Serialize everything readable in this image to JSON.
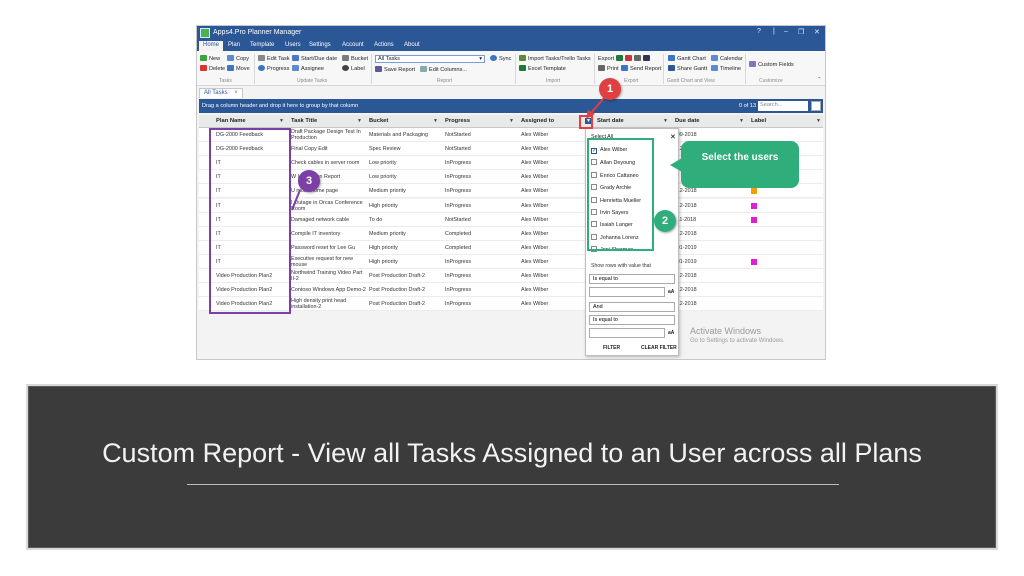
{
  "app": {
    "title": "Apps4.Pro Planner Manager",
    "window_controls": [
      "?",
      "|",
      "–",
      "❐",
      "✕"
    ],
    "menu_tabs": [
      "Home",
      "Plan",
      "Template",
      "Users",
      "Settings",
      "Account",
      "Actions",
      "About"
    ],
    "active_tab": "Home"
  },
  "ribbon": {
    "tasks": {
      "new": "New",
      "copy": "Copy",
      "delete": "Delete",
      "move": "Move",
      "group": "Tasks"
    },
    "update": {
      "edit_task": "Edit Task",
      "start_due": "Start/Due date",
      "bucket": "Bucket",
      "progress": "Progress",
      "assignee": "Assignee",
      "label": "Label",
      "group": "Update Tasks"
    },
    "report": {
      "selected": "All Tasks",
      "sync": "Sync",
      "save_report": "Save Report",
      "edit_columns": "Edit Columns...",
      "group": "Report"
    },
    "import": {
      "import_tasks": "Import Tasks/Trello Tasks",
      "excel_template": "Excel Template",
      "group": "Import"
    },
    "export": {
      "export": "Export",
      "print": "Print",
      "send_report": "Send Report",
      "group": "Export"
    },
    "gantt": {
      "gantt_chart": "Gantt Chart",
      "calendar": "Calendar",
      "share_gantt": "Share Gantt",
      "timeline": "Timeline",
      "group": "Gantt Chart and View"
    },
    "customize": {
      "custom_fields": "Custom Fields",
      "group": "Customize"
    }
  },
  "doc_tab": {
    "label": "All Tasks",
    "close": "×"
  },
  "group_bar": {
    "hint": "Drag a column header and drop it here to group by that column",
    "count": "0 of 13",
    "search_placeholder": "Search..."
  },
  "columns": [
    "Plan Name",
    "Task Title",
    "Bucket",
    "Progress",
    "Assigned to",
    "Start date",
    "Due date",
    "Label"
  ],
  "rows": [
    {
      "plan": "DG-2000 Feedback",
      "title": "Draft Package Design Test In Production",
      "bucket": "Materials and Packaging",
      "progress": "NotStarted",
      "assigned": "Alex Wilber",
      "due": "-09-2018",
      "label": ""
    },
    {
      "plan": "DG-2000 Feedback",
      "title": "Final Copy Edit",
      "bucket": "Spec Review",
      "progress": "NotStarted",
      "assigned": "Alex Wilber",
      "due": "-12-2",
      "label": ""
    },
    {
      "plan": "IT",
      "title": "Check cables in server room",
      "bucket": "Low priority",
      "progress": "InProgress",
      "assigned": "Alex Wilber",
      "due": "-01-",
      "label": ""
    },
    {
      "plan": "IT",
      "title": "W    Innovation Report",
      "bucket": "Low priority",
      "progress": "InProgress",
      "assigned": "Alex Wilber",
      "due": "",
      "label": ""
    },
    {
      "plan": "IT",
      "title": "U    ntoso home page",
      "bucket": "Medium priority",
      "progress": "InProgress",
      "assigned": "Alex Wilber",
      "due": "-12-2018",
      "label": "orange"
    },
    {
      "plan": "IT",
      "title": "I    Outage in Orcas Conference Room",
      "bucket": "High priority",
      "progress": "InProgress",
      "assigned": "Alex Wilber",
      "due": "-12-2018",
      "label": "magenta"
    },
    {
      "plan": "IT",
      "title": "Damaged network cable",
      "bucket": "To do",
      "progress": "NotStarted",
      "assigned": "Alex Wilber",
      "due": "-11-2018",
      "label": "magenta"
    },
    {
      "plan": "IT",
      "title": "Compile IT inventory",
      "bucket": "Medium priority",
      "progress": "Completed",
      "assigned": "Alex Wilber",
      "due": "-12-2018",
      "label": ""
    },
    {
      "plan": "IT",
      "title": "Password reset for Lee Gu",
      "bucket": "High priority",
      "progress": "Completed",
      "assigned": "Alex Wilber",
      "due": "-01-2019",
      "label": ""
    },
    {
      "plan": "IT",
      "title": "Executive request for new mouse",
      "bucket": "High priority",
      "progress": "InProgress",
      "assigned": "Alex Wilber",
      "due": "-01-2019",
      "label": "magenta"
    },
    {
      "plan": "Video Production Plan2",
      "title": "Northwind Training Video Part II-2",
      "bucket": "Post Production Draft-2",
      "progress": "InProgress",
      "assigned": "Alex Wilber",
      "due": "-12-2018",
      "label": ""
    },
    {
      "plan": "Video Production Plan2",
      "title": "Contoso Windows App Demo-2",
      "bucket": "Post Production Draft-2",
      "progress": "InProgress",
      "assigned": "Alex Wilber",
      "due": "-12-2018",
      "label": ""
    },
    {
      "plan": "Video Production Plan2",
      "title": "High density print head installation-2",
      "bucket": "Post Production Draft-2",
      "progress": "InProgress",
      "assigned": "Alex Wilber",
      "due": "-12-2018",
      "label": ""
    }
  ],
  "filter_dropdown": {
    "select_all": "Select All",
    "users": [
      {
        "name": "Alex Wilber",
        "checked": true
      },
      {
        "name": "Allan Deyoung",
        "checked": false
      },
      {
        "name": "Enrico Cattaneo",
        "checked": false
      },
      {
        "name": "Grady Archie",
        "checked": false
      },
      {
        "name": "Henrietta Mueller",
        "checked": false
      },
      {
        "name": "Irvin Sayers",
        "checked": false
      },
      {
        "name": "Isaiah Langer",
        "checked": false
      },
      {
        "name": "Johanna Lorenz",
        "checked": false
      },
      {
        "name": "Joni Sherman",
        "checked": false
      }
    ],
    "show_rows": "Show rows with value that",
    "op1": "Is equal to",
    "and_op": "And",
    "op2": "Is equal to",
    "case_btn": "aA",
    "filter_btn": "FILTER",
    "clear_btn": "CLEAR FILTER"
  },
  "watermark": {
    "title": "Activate Windows",
    "subtitle": "Go to Settings to activate Windows."
  },
  "callouts": {
    "one": "1",
    "two": "2",
    "three": "3",
    "bubble": "Select the users"
  },
  "colors": {
    "label_orange": "#f0a000",
    "label_magenta": "#e020d0",
    "purple": "#7b3fa6",
    "green": "#2fae7c",
    "red": "#e04040"
  },
  "caption": "Custom Report - View all Tasks Assigned to an User across all Plans"
}
